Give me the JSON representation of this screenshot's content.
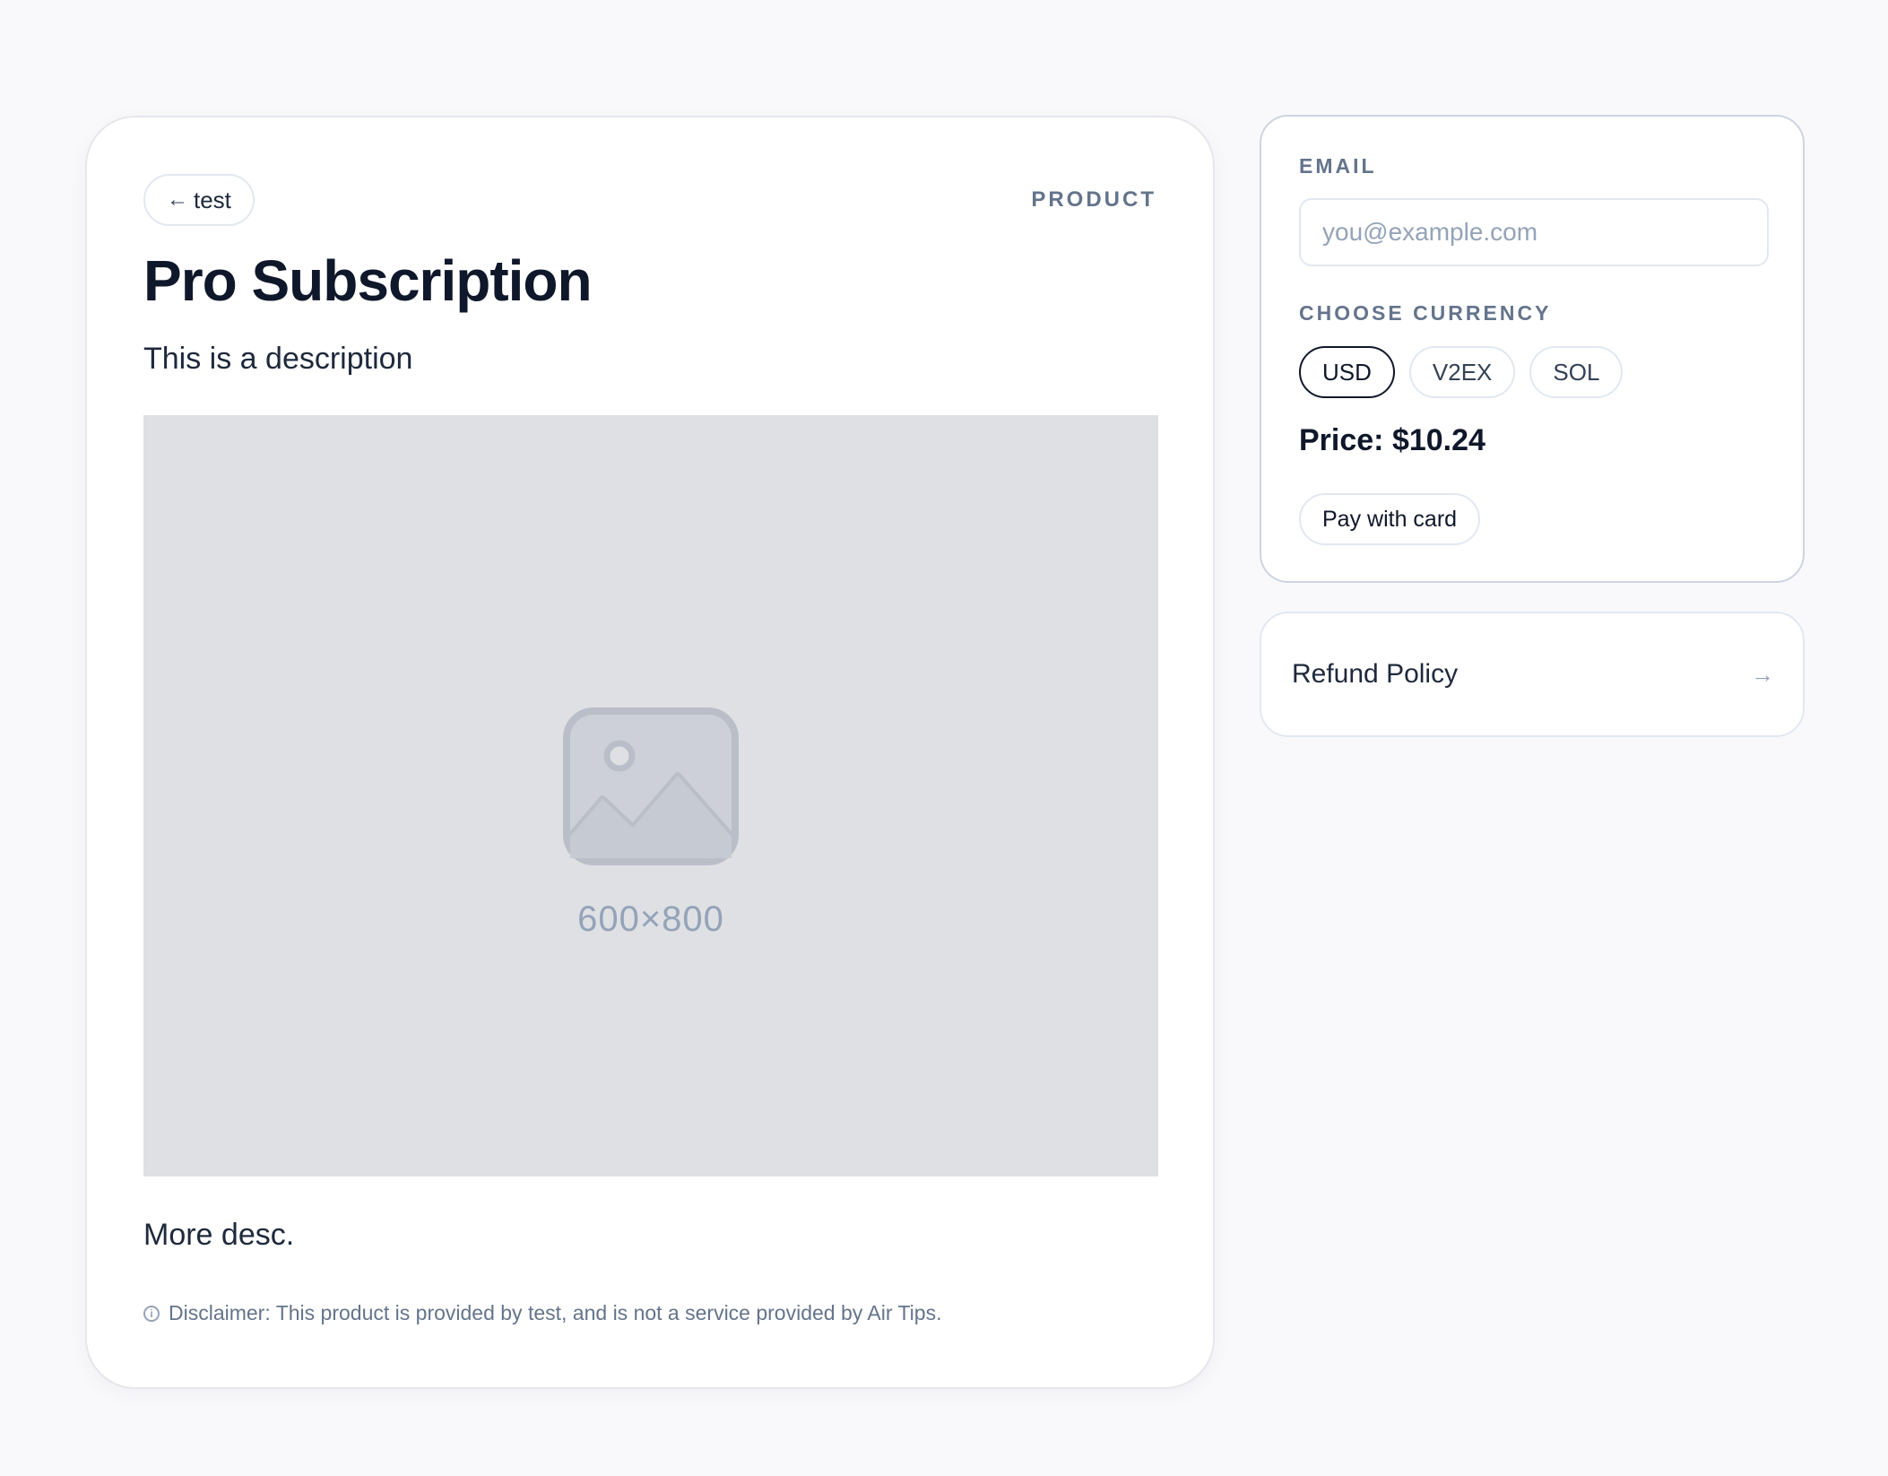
{
  "product": {
    "back_label": "test",
    "tag": "PRODUCT",
    "title": "Pro Subscription",
    "description": "This is a description",
    "image_placeholder_text": "600×800",
    "more_description": "More desc.",
    "disclaimer": "Disclaimer: This product is provided by test, and is not a service provided by Air Tips."
  },
  "checkout": {
    "email_label": "EMAIL",
    "email_placeholder": "you@example.com",
    "currency_label": "CHOOSE CURRENCY",
    "currencies": [
      "USD",
      "V2EX",
      "SOL"
    ],
    "selected_currency": "USD",
    "price_text": "Price: $10.24",
    "pay_button_label": "Pay with card"
  },
  "refund": {
    "label": "Refund Policy"
  },
  "icons": {
    "back": "arrow-left-icon",
    "image": "image-placeholder-icon",
    "info": "info-icon",
    "refund_arrow": "arrow-right-icon"
  }
}
